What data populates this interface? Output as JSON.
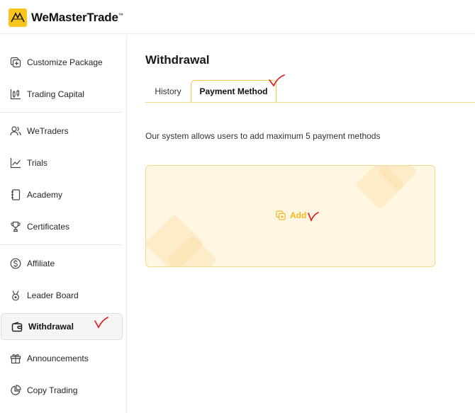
{
  "app": {
    "name": "WeMasterTrade",
    "trademark": "™"
  },
  "sidebar": {
    "items": [
      {
        "label": "Customize Package",
        "icon": "square-plus-icon"
      },
      {
        "label": "Trading Capital",
        "icon": "candlestick-icon"
      },
      {
        "label": "WeTraders",
        "icon": "users-icon"
      },
      {
        "label": "Trials",
        "icon": "line-chart-icon"
      },
      {
        "label": "Academy",
        "icon": "notebook-icon"
      },
      {
        "label": "Certificates",
        "icon": "trophy-icon"
      },
      {
        "label": "Affiliate",
        "icon": "dollar-circle-icon"
      },
      {
        "label": "Leader Board",
        "icon": "medal-icon"
      },
      {
        "label": "Withdrawal",
        "icon": "wallet-icon",
        "active": true
      },
      {
        "label": "Announcements",
        "icon": "gift-icon"
      },
      {
        "label": "Copy Trading",
        "icon": "pie-chart-icon"
      }
    ]
  },
  "main": {
    "title": "Withdrawal",
    "tabs": [
      {
        "label": "History",
        "active": false
      },
      {
        "label": "Payment Method",
        "active": true
      }
    ],
    "info": "Our system allows users to add maximum 5 payment methods",
    "add_label": "Add"
  },
  "colors": {
    "brand": "#f7c51e",
    "accent": "#f3b91e",
    "card_bg": "#fff6e3",
    "annotation": "#e0141c"
  }
}
